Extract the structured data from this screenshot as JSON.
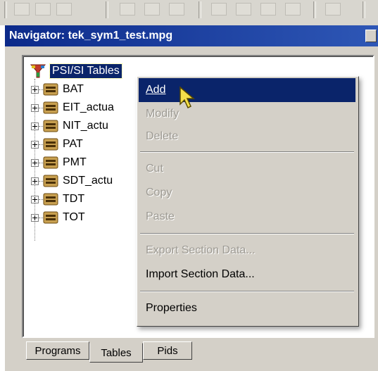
{
  "window": {
    "title": "Navigator: tek_sym1_test.mpg"
  },
  "tree": {
    "root_label": "PSI/SI Tables",
    "root_icon": "funnel-tree-icon",
    "items": [
      {
        "label": "BAT",
        "icon": "table-icon"
      },
      {
        "label": "EIT_actua",
        "icon": "table-icon"
      },
      {
        "label": "NIT_actu",
        "icon": "table-icon"
      },
      {
        "label": "PAT",
        "icon": "table-icon"
      },
      {
        "label": "PMT",
        "icon": "table-icon"
      },
      {
        "label": "SDT_actu",
        "icon": "table-icon"
      },
      {
        "label": "TDT",
        "icon": "table-icon"
      },
      {
        "label": "TOT",
        "icon": "table-icon"
      }
    ]
  },
  "context_menu": {
    "items": {
      "add": "Add",
      "modify": "Modify",
      "delete": "Delete",
      "cut": "Cut",
      "copy": "Copy",
      "paste": "Paste",
      "export": "Export Section Data...",
      "import": "Import Section Data...",
      "properties": "Properties"
    }
  },
  "tabs": {
    "programs": "Programs",
    "tables": "Tables",
    "pids": "Pids",
    "active": "Tables"
  },
  "colors": {
    "menu_highlight": "#0a246a",
    "title_bar": "#0c2a8a",
    "face": "#d4d0c8",
    "disabled_text": "#9d9a93"
  }
}
